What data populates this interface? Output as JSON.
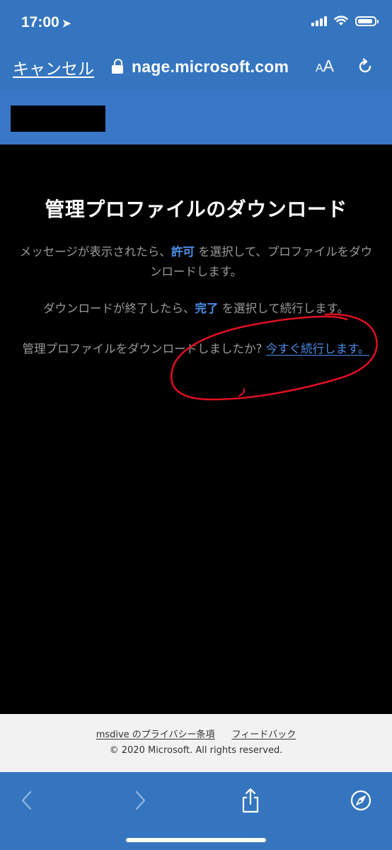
{
  "status_bar": {
    "time": "17:00"
  },
  "nav_bar": {
    "cancel_label": "キャンセル",
    "url": "nage.microsoft.com",
    "text_size_small": "A",
    "text_size_large": "A"
  },
  "main": {
    "title": "管理プロファイルのダウンロード",
    "instruction_1": {
      "before": "メッセージが表示されたら、",
      "highlight": "許可",
      "after": " を選択して、プロファイルをダウンロードします。"
    },
    "instruction_2": {
      "before": "ダウンロードが終了したら、",
      "highlight": "完了",
      "after": " を選択して続行します。"
    },
    "instruction_3": {
      "question": "管理プロファイルをダウンロードしましたか? ",
      "link": "今すぐ続行します。"
    }
  },
  "footer": {
    "privacy_link": "msdive のプライバシー条項",
    "feedback_link": "フィードバック",
    "copyright": "© 2020 Microsoft. All rights reserved."
  },
  "colors": {
    "header_blue": "#3575bf",
    "link_blue": "#4b8fe8",
    "annotation_red": "#e01020"
  }
}
